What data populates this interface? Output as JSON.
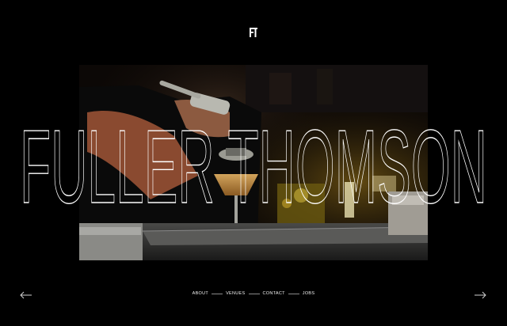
{
  "brand": {
    "monogram": "FT",
    "wordmark": "FULLER THOMSON"
  },
  "nav": {
    "items": [
      {
        "label": "ABOUT"
      },
      {
        "label": "VENUES"
      },
      {
        "label": "CONTACT"
      },
      {
        "label": "JOBS"
      }
    ]
  },
  "colors": {
    "background": "#000000",
    "text": "#ffffff"
  },
  "icons": {
    "prev": "arrow-left-icon",
    "next": "arrow-right-icon"
  }
}
